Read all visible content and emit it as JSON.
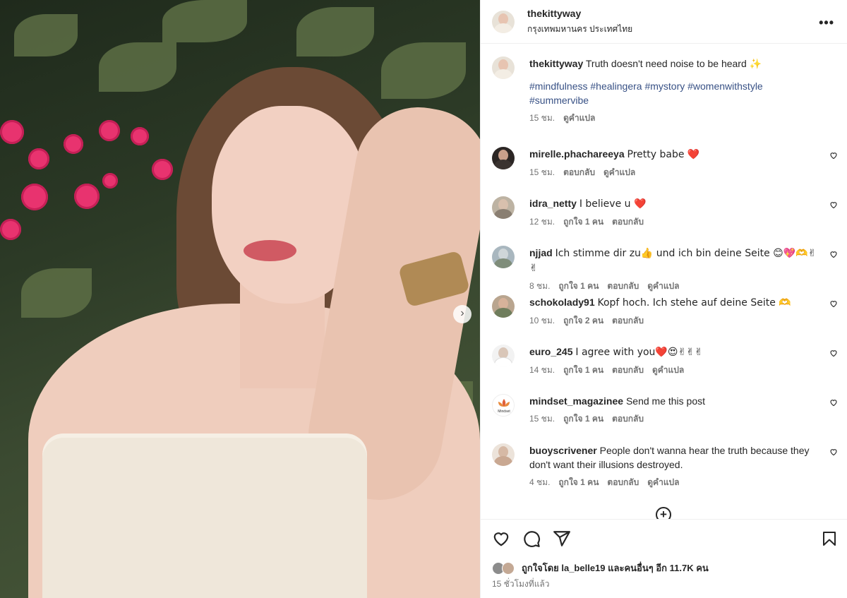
{
  "post": {
    "author": "thekittyway",
    "location": "กรุงเทพมหานคร ประเทศไทย",
    "caption": "Truth doesn't need noise to be heard ✨",
    "hashtags_line1": "#mindfulness #healingera #mystory #womenwithstyle",
    "hashtags_line2": "#summervibe",
    "caption_time": "15 ชม.",
    "translate_label": "ดูคำแปล"
  },
  "comments": [
    {
      "user": "mirelle.phachareeya",
      "text": "Pretty babe ❤️",
      "time": "15 ชม.",
      "likes": "",
      "reply": "ตอบกลับ",
      "translate": "ดูคำแปล"
    },
    {
      "user": "idra_netty",
      "text": "I believe u ❤️",
      "time": "12 ชม.",
      "likes": "ถูกใจ 1 คน",
      "reply": "ตอบกลับ",
      "translate": ""
    },
    {
      "user": "njjad",
      "text": "Ich stimme dir zu👍 und ich bin deine Seite 😊💖🫶✌✌",
      "time": "8 ชม.",
      "likes": "ถูกใจ 1 คน",
      "reply": "ตอบกลับ",
      "translate": "ดูคำแปล"
    },
    {
      "user": "schokolady91",
      "text": "Kopf hoch. Ich stehe auf deine Seite 🫶",
      "time": "10 ชม.",
      "likes": "ถูกใจ 2 คน",
      "reply": "ตอบกลับ",
      "translate": ""
    },
    {
      "user": "euro_245",
      "text": "I agree with you❤️😍✌✌✌",
      "time": "14 ชม.",
      "likes": "ถูกใจ 1 คน",
      "reply": "ตอบกลับ",
      "translate": "ดูคำแปล"
    },
    {
      "user": "mindset_magazinee",
      "text": "Send me this post",
      "time": "15 ชม.",
      "likes": "ถูกใจ 1 คน",
      "reply": "ตอบกลับ",
      "translate": ""
    },
    {
      "user": "buoyscrivener",
      "text": "People don't wanna hear the truth because they don't want their illusions destroyed.",
      "time": "4 ชม.",
      "likes": "ถูกใจ 1 คน",
      "reply": "ตอบกลับ",
      "translate": "ดูคำแปล"
    }
  ],
  "mindset_logo_text": "Mindset",
  "footer": {
    "liked_by": "ถูกใจโดย la_belle19 และคนอื่นๆ อีก 11.7K คน",
    "posted_ago": "15 ชั่วโมงที่แล้ว"
  },
  "icons": {
    "more": "more-options-icon",
    "like": "heart-icon",
    "comment": "comment-icon",
    "share": "share-icon",
    "save": "bookmark-icon",
    "load_more": "plus-circle-icon",
    "next": "chevron-right-icon"
  },
  "colors": {
    "text": "#262626",
    "secondary": "#737373",
    "hashtag": "#385185",
    "border": "#efefef"
  }
}
